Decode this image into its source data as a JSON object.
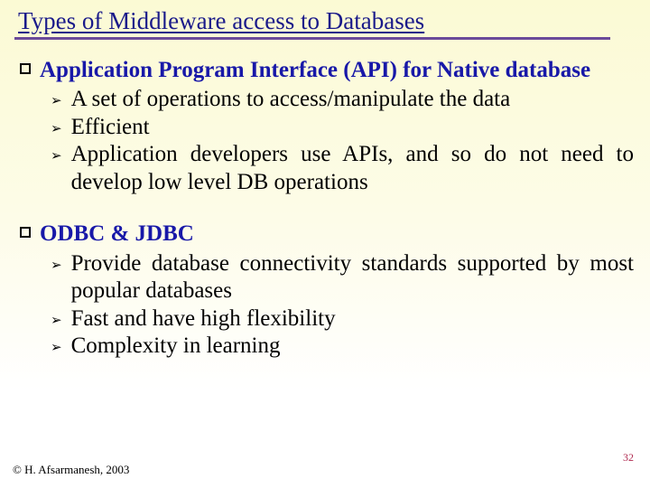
{
  "title": "Types of Middleware access to Databases",
  "items": [
    {
      "label": "Application Program Interface (API) for Native database",
      "subs": [
        "A set of operations to access/manipulate the data",
        "Efficient",
        "Application developers use APIs, and so do not need to develop low level DB operations"
      ]
    },
    {
      "label": "ODBC & JDBC",
      "subs": [
        "Provide database connectivity standards supported by most popular databases",
        "Fast and have high flexibility",
        "Complexity in learning"
      ]
    }
  ],
  "footer": "© H. Afsarmanesh, 2003",
  "page": "32"
}
